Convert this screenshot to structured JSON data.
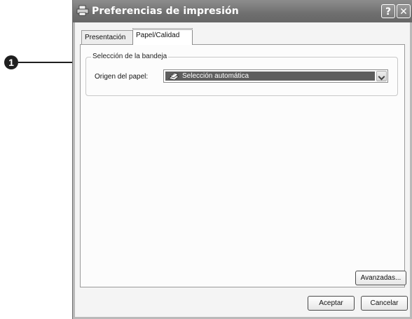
{
  "callout": {
    "number": "1"
  },
  "window": {
    "title": "Preferencias de impresión",
    "help_button": "?",
    "close_button": "✕"
  },
  "tabs": [
    {
      "label": "Presentación",
      "active": false
    },
    {
      "label": "Papel/Calidad",
      "active": true
    }
  ],
  "tray_group": {
    "legend": "Selección de la bandeja",
    "origin_label": "Origen del papel:",
    "origin_value": "Selección automática"
  },
  "buttons": {
    "advanced": "Avanzadas...",
    "ok": "Aceptar",
    "cancel": "Cancelar"
  },
  "colors": {
    "title_bar": "#767676",
    "selection": "#5e5e5e"
  }
}
